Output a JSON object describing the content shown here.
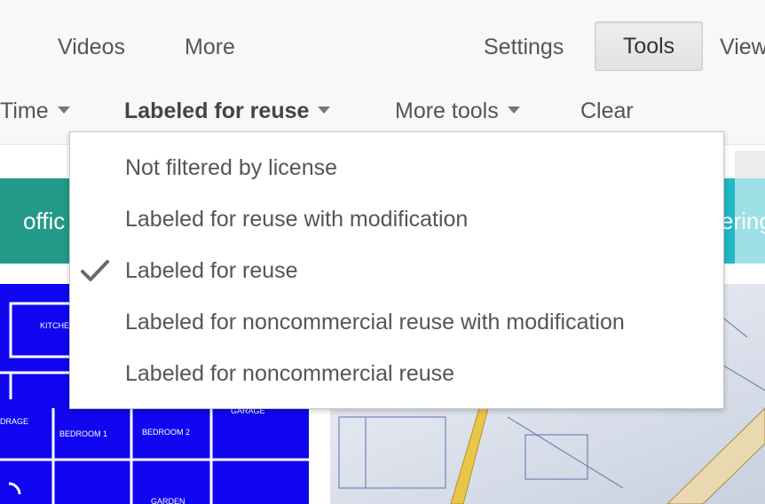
{
  "nav": {
    "videos": "Videos",
    "more": "More",
    "settings": "Settings",
    "tools": "Tools",
    "view": "View"
  },
  "toolbar": {
    "time": "Time",
    "license": "Labeled for reuse",
    "more_tools": "More tools",
    "clear": "Clear"
  },
  "results": {
    "chip_left": "offic",
    "chip_right": "ering",
    "floorplan_labels": [
      "KITCHEN",
      "DRAGE",
      "BEDROOM 1",
      "BEDROOM 2",
      "GARAGE",
      "GARDEN"
    ]
  },
  "license_menu": {
    "selected_index": 2,
    "items": [
      "Not filtered by license",
      "Labeled for reuse with modification",
      "Labeled for reuse",
      "Labeled for noncommercial reuse with modification",
      "Labeled for noncommercial reuse"
    ]
  },
  "colors": {
    "chip_teal": "#229a87",
    "chip_cyan": "#24b7c6",
    "floorplan_blue": "#1006f0",
    "menu_text": "#555555"
  },
  "icons": [
    "check-icon",
    "caret-down-icon"
  ]
}
